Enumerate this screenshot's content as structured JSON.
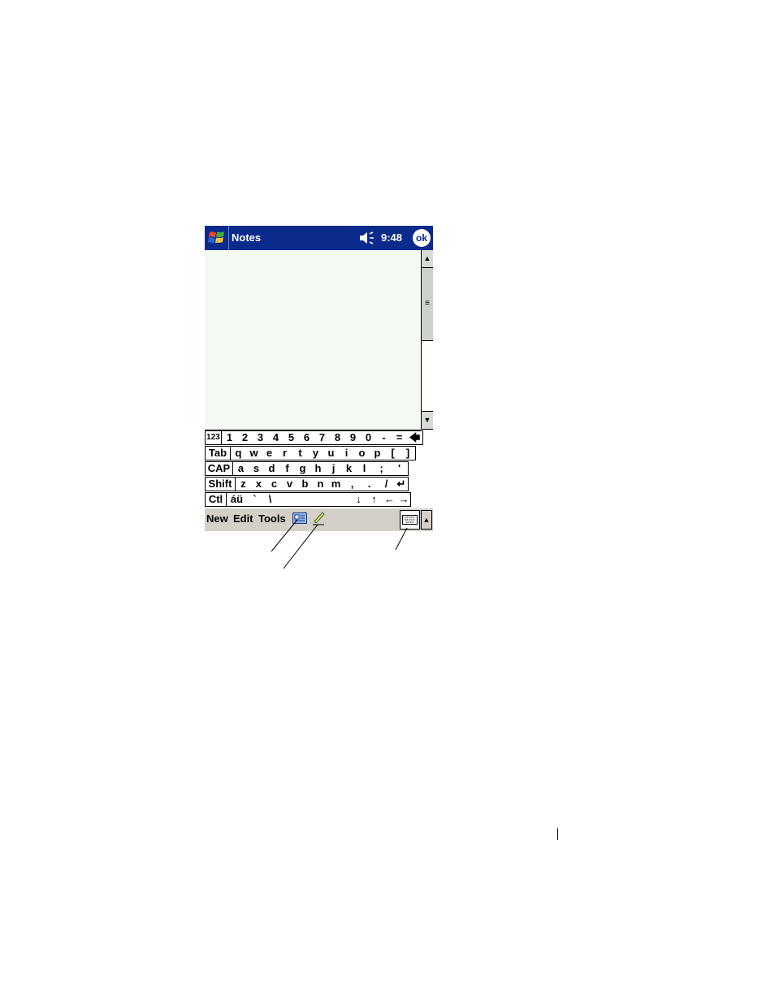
{
  "titlebar": {
    "app_title": "Notes",
    "time": "9:48",
    "ok_label": "ok",
    "start_icon": "windows-flag-icon",
    "volume_icon": "speaker-icon",
    "bg_color": "#0a2a8c"
  },
  "note": {
    "bg_color": "#f4f9f4"
  },
  "scrollbar": {
    "up": "▲",
    "down": "▼",
    "thumb": "≡"
  },
  "keyboard": {
    "rows": [
      [
        "123",
        "1",
        "2",
        "3",
        "4",
        "5",
        "6",
        "7",
        "8",
        "9",
        "0",
        "-",
        "=",
        "🡄"
      ],
      [
        "Tab",
        "q",
        "w",
        "e",
        "r",
        "t",
        "y",
        "u",
        "i",
        "o",
        "p",
        "[",
        "]"
      ],
      [
        "CAP",
        "a",
        "s",
        "d",
        "f",
        "g",
        "h",
        "j",
        "k",
        "l",
        ";",
        "'"
      ],
      [
        "Shift",
        "z",
        "x",
        "c",
        "v",
        "b",
        "n",
        "m",
        ",",
        ".",
        "/",
        "↵"
      ],
      [
        "Ctl",
        "áü",
        "`",
        "\\",
        "",
        "↓",
        "↑",
        "←",
        "→"
      ]
    ]
  },
  "menubar": {
    "items": [
      "New",
      "Edit",
      "Tools"
    ],
    "ink_icon": "recording-icon",
    "pen_icon": "pen-icon",
    "input_icon": "keyboard-icon",
    "sip_arrow": "▲"
  }
}
